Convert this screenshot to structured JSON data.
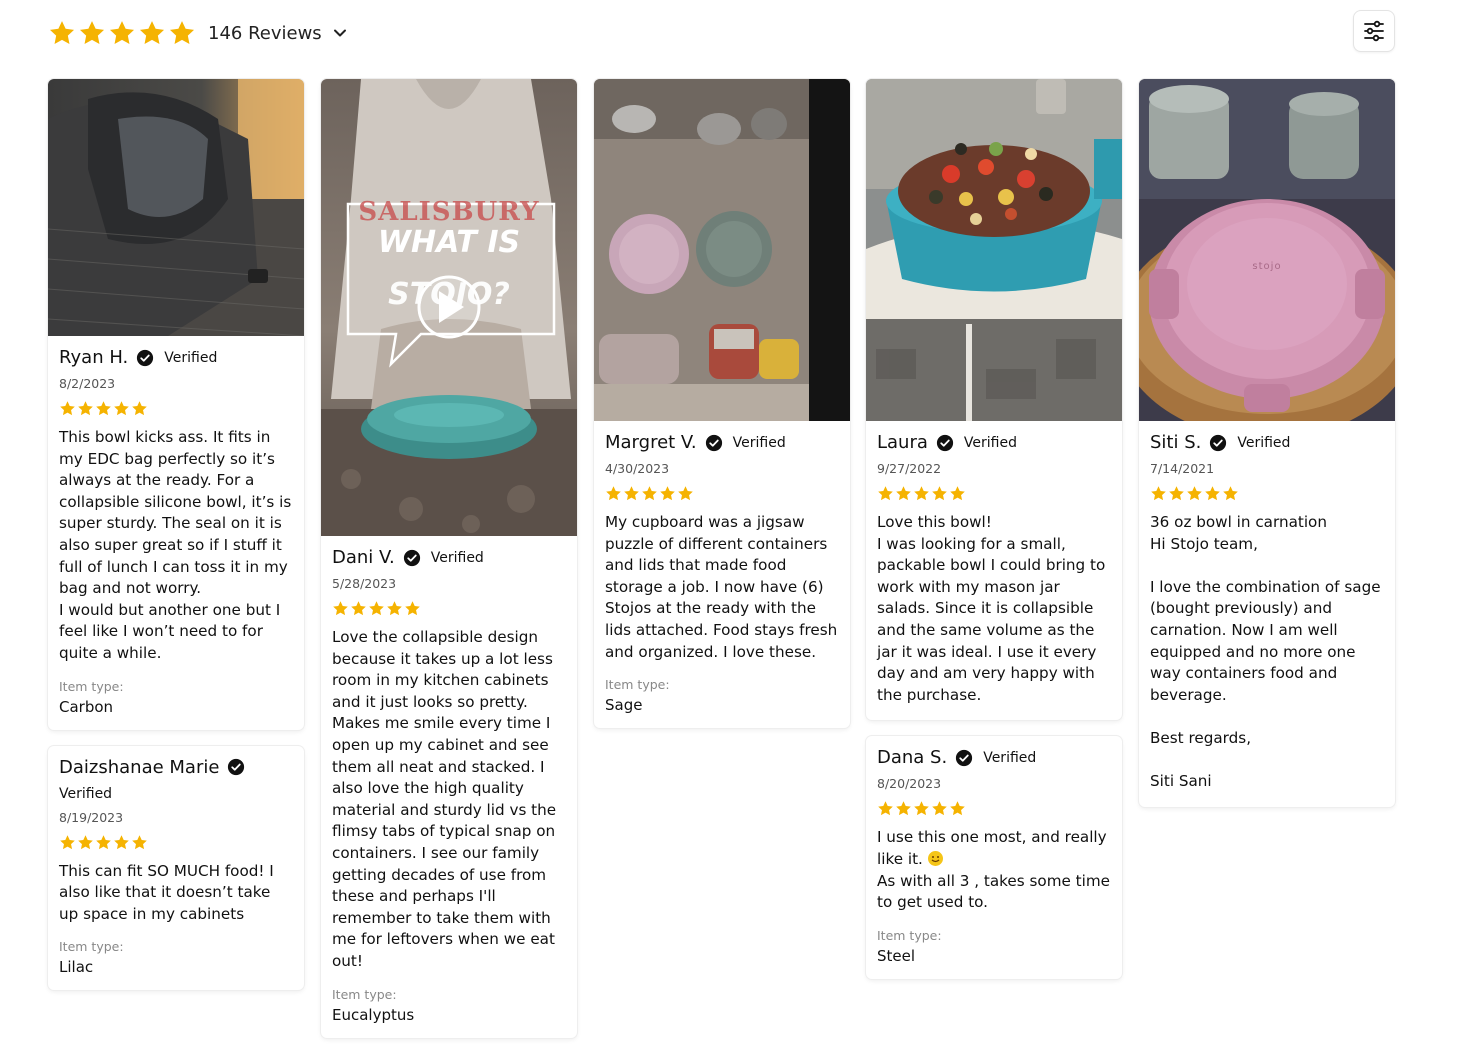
{
  "header": {
    "rating_stars": 5,
    "reviews_label": "146 Reviews",
    "star_color": "#F5B301"
  },
  "filter": {
    "icon": "sliders-icon"
  },
  "reviews": [
    {
      "id": "ryan",
      "name": "Ryan H.",
      "verified": "Verified",
      "date": "8/2/2023",
      "stars": 5,
      "text": "This bowl kicks ass. It fits in my EDC bag perfectly so it’s always at the ready. For a collapsible silicone bowl, it’s is super sturdy. The seal on it is also super great so if I stuff it full of lunch I can toss it in my bag and not worry.\nI would but another one but I feel like I won’t need to for quite a while.",
      "item_type_label": "Item type:",
      "item_type": "Carbon"
    },
    {
      "id": "daizshanae",
      "name": "Daizshanae Marie",
      "verified": "Verified",
      "date": "8/19/2023",
      "stars": 5,
      "text": "This can fit SO MUCH food! I also like that it doesn’t take up space in my cabinets",
      "item_type_label": "Item type:",
      "item_type": "Lilac"
    },
    {
      "id": "dani",
      "name": "Dani V.",
      "verified": "Verified",
      "date": "5/28/2023",
      "stars": 5,
      "text": "Love the collapsible design because it takes up a lot less room in my kitchen cabinets and it just looks so pretty. Makes me smile every time I open up my cabinet and see them all neat and  stacked. I also love the high quality material and sturdy lid vs the flimsy tabs of typical snap on containers. I see our family getting decades of use from these and perhaps I'll remember to take them with me for leftovers when we eat out!",
      "item_type_label": "Item type:",
      "item_type": "Eucalyptus",
      "video_text_1": "WHAT IS",
      "video_text_2": "STOJO?",
      "hoodie_text": "SALISBURY"
    },
    {
      "id": "margret",
      "name": "Margret V.",
      "verified": "Verified",
      "date": "4/30/2023",
      "stars": 5,
      "text": "My cupboard was a jigsaw puzzle of different containers and lids that made food storage a job.  I now have (6) Stojos at the ready with the lids attached.  Food stays fresh and organized.  I love these.",
      "item_type_label": "Item type:",
      "item_type": "Sage"
    },
    {
      "id": "laura",
      "name": "Laura",
      "verified": "Verified",
      "date": "9/27/2022",
      "stars": 5,
      "text": "Love this bowl!\nI was looking for a small, packable bowl I could bring to work with my mason jar salads. Since it is collapsible and the same volume as the jar it was ideal. I use it every day and am very happy with the purchase."
    },
    {
      "id": "dana",
      "name": "Dana S.",
      "verified": "Verified",
      "date": "8/20/2023",
      "stars": 5,
      "text_before_emoji": "I use this one most, and really like it.",
      "text_after_emoji": "As with all 3 , takes some time to get used to.",
      "item_type_label": "Item type:",
      "item_type": "Steel"
    },
    {
      "id": "siti",
      "name": "Siti S.",
      "verified": "Verified",
      "date": "7/14/2021",
      "stars": 5,
      "text": "36 oz bowl in carnation\nHi Stojo team,\n\nI love the combination of sage (bought previously) and carnation. Now I am well equipped and no more one way containers food and beverage.\n\nBest regards,\n\nSiti Sani",
      "lid_logo": "stojo"
    }
  ]
}
